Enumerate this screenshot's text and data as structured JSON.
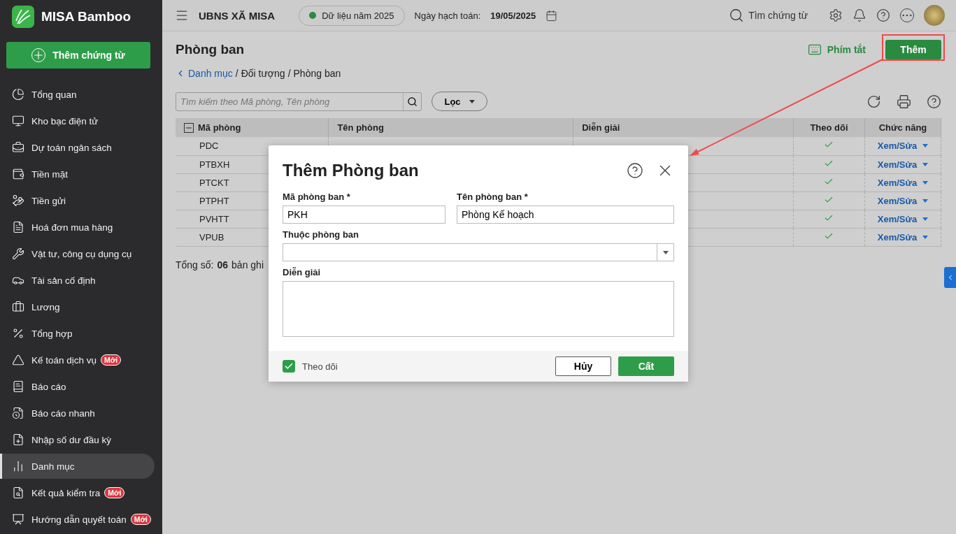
{
  "app": {
    "name": "MISA Bamboo"
  },
  "sidebar": {
    "add_button": "Thêm chứng từ",
    "items": [
      {
        "label": "Tổng quan",
        "selected": false
      },
      {
        "label": "Kho bạc điện tử",
        "selected": false
      },
      {
        "label": "Dự toán ngân sách",
        "selected": false
      },
      {
        "label": "Tiền mặt",
        "selected": false
      },
      {
        "label": "Tiền gửi",
        "selected": false
      },
      {
        "label": "Hoá đơn mua hàng",
        "selected": false
      },
      {
        "label": "Vật tư, công cụ dụng cụ",
        "selected": false
      },
      {
        "label": "Tài sản cố định",
        "selected": false
      },
      {
        "label": "Lương",
        "selected": false
      },
      {
        "label": "Tổng hợp",
        "selected": false
      },
      {
        "label": "Kế toán dịch vụ",
        "selected": false,
        "badge": "Mới"
      },
      {
        "label": "Báo cáo",
        "selected": false
      },
      {
        "label": "Báo cáo nhanh",
        "selected": false
      },
      {
        "label": "Nhập số dư đầu kỳ",
        "selected": false
      },
      {
        "label": "Danh mục",
        "selected": true
      },
      {
        "label": "Kết quả kiểm tra",
        "selected": false,
        "badge": "Mới"
      },
      {
        "label": "Hướng dẫn quyết toán",
        "selected": false,
        "badge": "Mới"
      }
    ]
  },
  "topbar": {
    "org": "UBNS XÃ MISA",
    "data_year": {
      "label": "Dữ liệu năm 2025",
      "color": "#2a8a3f"
    },
    "date_label": "Ngày hạch toán:",
    "date": "19/05/2025",
    "search": "Tìm chứng từ"
  },
  "page": {
    "title": "Phòng ban",
    "breadcrumb": [
      {
        "label": "Danh mục",
        "kind": "link"
      },
      {
        "label": "Đối tượng",
        "kind": "text"
      },
      {
        "label": "Phòng ban",
        "kind": "text"
      }
    ],
    "separator": "/",
    "shortcut": "Phím tắt",
    "add_button": "Thêm"
  },
  "toolbar": {
    "search_placeholder": "Tìm kiếm theo Mã phòng, Tên phòng",
    "filter": "Lọc"
  },
  "table": {
    "select_all": {
      "indeterminate": true
    },
    "columns": [
      "Mã phòng",
      "Tên phòng",
      "Diễn giải",
      "Theo dõi",
      "Chức năng"
    ],
    "rows": [
      {
        "code": "PDC",
        "following": true,
        "action": "Xem/Sửa"
      },
      {
        "code": "PTBXH",
        "following": true,
        "action": "Xem/Sửa"
      },
      {
        "code": "PTCKT",
        "following": true,
        "action": "Xem/Sửa"
      },
      {
        "code": "PTPHT",
        "following": true,
        "action": "Xem/Sửa"
      },
      {
        "code": "PVHTT",
        "following": true,
        "action": "Xem/Sửa"
      },
      {
        "code": "VPUB",
        "following": true,
        "action": "Xem/Sửa"
      }
    ]
  },
  "total": {
    "label": "Tổng số:",
    "count": "06",
    "unit": "bản ghi"
  },
  "dialog": {
    "title": "Thêm Phòng ban",
    "code": {
      "label": "Mã phòng ban *",
      "value": "PKH"
    },
    "name": {
      "label": "Tên phòng ban *",
      "value": "Phòng Kế hoạch"
    },
    "parent": {
      "label": "Thuộc phòng ban"
    },
    "description": {
      "label": "Diễn giải"
    },
    "follow": {
      "label": "Theo dõi",
      "checked": true
    },
    "cancel": "Hủy",
    "save": "Cất"
  }
}
